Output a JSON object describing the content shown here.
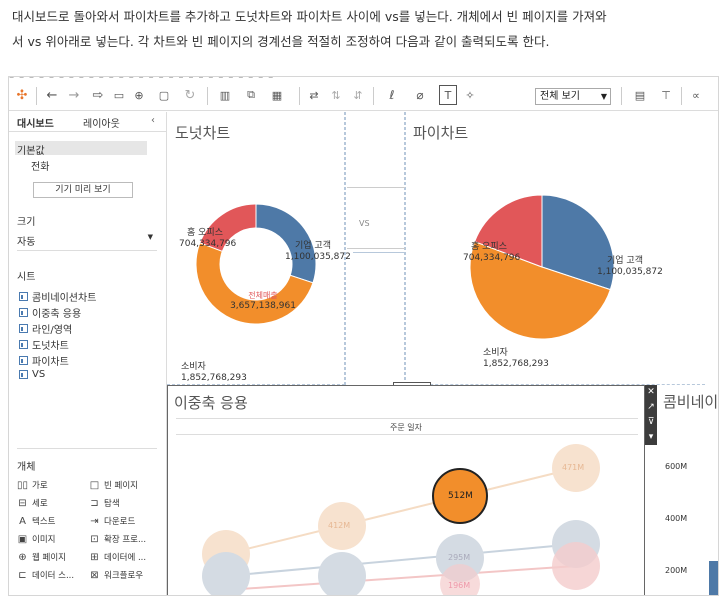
{
  "intro": {
    "line1": "대시보드로 돌아와서 파이차트를 추가하고 도넛차트와 파이차트 사이에 vs를 넣는다. 개체에서 빈 페이지를 가져와",
    "line2": "서 vs 위아래로 넣는다. 각 차트와 빈 페이지의 경계선을 적절히 조정하여 다음과 같이 출력되도록 한다."
  },
  "toolbar": {
    "sheet_select": "전체 보기"
  },
  "sidebar": {
    "tabs": [
      "대시보드",
      "레이아웃"
    ],
    "device_default": "기본값",
    "device_phone": "전화",
    "preview_button": "기기 미리 보기",
    "size_heading": "크기",
    "size_value": "자동",
    "sheets_heading": "시트",
    "sheets": [
      "콤비네이션차트",
      "이중축 응용",
      "라인/영역",
      "도넛차트",
      "파이차트",
      "VS"
    ],
    "objects_heading": "개체",
    "objects": [
      {
        "icon": "horizontal-icon",
        "label": "가로"
      },
      {
        "icon": "blank-icon",
        "label": "빈 페이지"
      },
      {
        "icon": "vertical-icon",
        "label": "세로"
      },
      {
        "icon": "navigation-icon",
        "label": "탐색"
      },
      {
        "icon": "text-icon",
        "label": "텍스트"
      },
      {
        "icon": "download-icon",
        "label": "다운로드"
      },
      {
        "icon": "image-icon",
        "label": "이미지"
      },
      {
        "icon": "extension-icon",
        "label": "확장 프로..."
      },
      {
        "icon": "webpage-icon",
        "label": "웹 페이지"
      },
      {
        "icon": "data-story-icon",
        "label": "데이터에 ..."
      },
      {
        "icon": "data-story2-icon",
        "label": "데이터 스..."
      },
      {
        "icon": "workflow-icon",
        "label": "워크플로우"
      }
    ]
  },
  "donut": {
    "title": "도넛차트",
    "center_label": "전체매출",
    "center_value": "3,657,138,961",
    "segments": [
      {
        "name": "홈 오피스",
        "value": "704,334,796",
        "color": "#e15759",
        "amount": 704334796
      },
      {
        "name": "기업 고객",
        "value": "1,100,035,872",
        "color": "#4e79a7",
        "amount": 1100035872
      },
      {
        "name": "소비자",
        "value": "1,852,768,293",
        "color": "#f28e2b",
        "amount": 1852768293
      }
    ]
  },
  "vs_label": "VS",
  "pie": {
    "title": "파이차트",
    "segments": [
      {
        "name": "홈 오피스",
        "value": "704,334,796",
        "color": "#e15759",
        "amount": 704334796
      },
      {
        "name": "기업 고객",
        "value": "1,100,035,872",
        "color": "#4e79a7",
        "amount": 1100035872
      },
      {
        "name": "소비자",
        "value": "1,852,768,293",
        "color": "#f28e2b",
        "amount": 1852768293
      }
    ]
  },
  "dual_axis": {
    "title": "이중축 응용",
    "header": "주문 일자",
    "bubbles": [
      "471M",
      "412M",
      "512M",
      "295M",
      "196M"
    ],
    "highlight": "512M"
  },
  "combo": {
    "title": "콤비네이",
    "ticks": [
      "600M",
      "400M",
      "200M"
    ]
  }
}
